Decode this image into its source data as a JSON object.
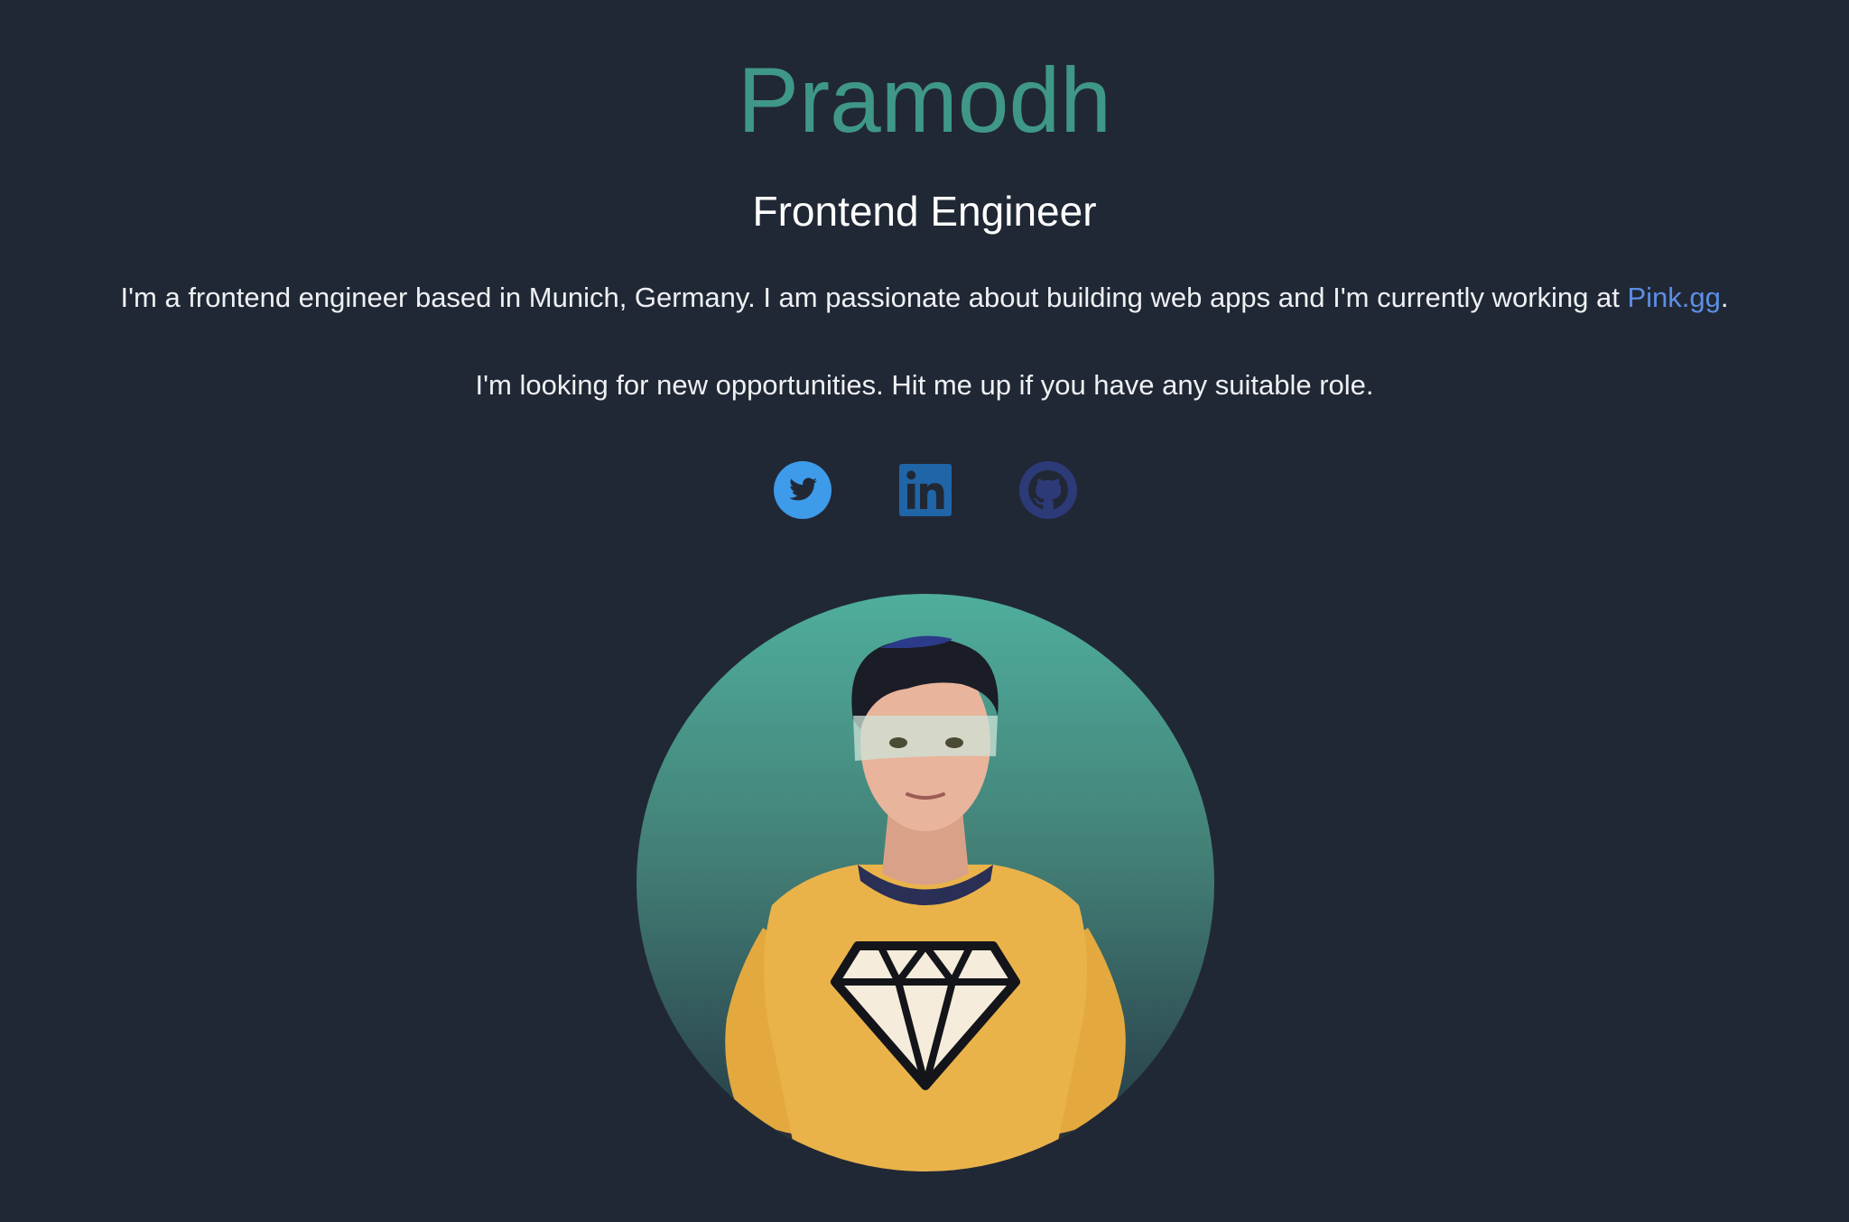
{
  "profile": {
    "name": "Pramodh",
    "role": "Frontend Engineer",
    "bio_text": "I'm a frontend engineer based in Munich, Germany. I am passionate about building web apps and I'm currently working at ",
    "company_link": "Pink.gg",
    "bio_end": ".",
    "looking": "I'm looking for new opportunities. Hit me up if you have any suitable role."
  },
  "socials": [
    {
      "icon": "twitter-icon",
      "color": "#3d9be9"
    },
    {
      "icon": "linkedin-icon",
      "color": "#1f65a8"
    },
    {
      "icon": "github-icon",
      "color": "#2d3a78"
    }
  ],
  "colors": {
    "background": "#212835",
    "name": "#3f9788",
    "link": "#5c8ee6",
    "text": "#eef0f3"
  },
  "avatar": {
    "icon": "avatar-illustration"
  }
}
